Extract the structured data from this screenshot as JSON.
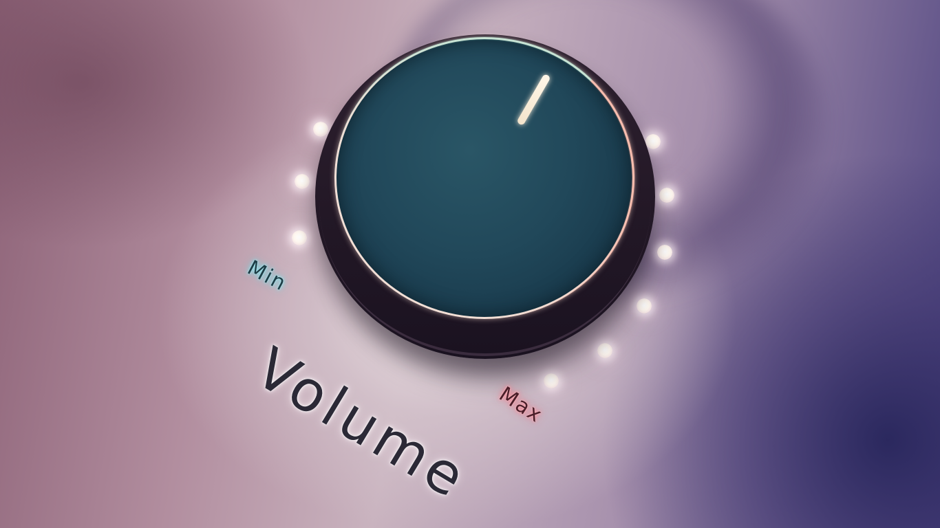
{
  "volume_control": {
    "label": "Volume",
    "min_label": "Min",
    "max_label": "Max",
    "knob_icon": "rotary-knob-icon",
    "indicator_icon": "pointer-line-icon",
    "led_count": 10,
    "colors": {
      "min_glow": "#7fe8f0",
      "max_glow": "#ff8c98",
      "knob_face": "#21485a",
      "knob_body": "#231826",
      "led": "#ffffff"
    }
  }
}
